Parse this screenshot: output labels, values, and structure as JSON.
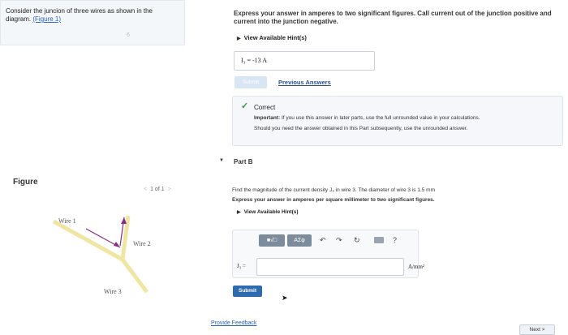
{
  "intro": {
    "text": "Consider the juncion of three wires as shown in the diagram. ",
    "figure_link": "(Figure 1)",
    "faint_digit": "6"
  },
  "figure": {
    "label": "Figure",
    "pager_prev": "<",
    "pager_text": "1 of 1",
    "pager_next": ">",
    "wire_labels": {
      "wire1": "Wire 1",
      "wire2": "Wire 2",
      "wire3": "Wire 3"
    }
  },
  "part_a": {
    "instruction": "Express your answer in amperes to two significant figures. Call current out of the junction positive and current into the junction negative.",
    "hints_label": "View Available Hint(s)",
    "answer": "I₃ = -13  A",
    "submit_label": "Submit",
    "previous_answers": "Previous Answers",
    "correct_title": "Correct",
    "correct_important": "Important:",
    "correct_line1": " If you use this answer in later parts, use the full unrounded value in your calculations.",
    "correct_line2": "Should you need the answer obtained in this Part subsequently, use the unrounded answer."
  },
  "part_b": {
    "title": "Part B",
    "question": "Find the magnitude of the current density J₃ in wire 3. The diameter of wire 3 is 1.5 mm",
    "instruction": "Express your answer in amperes per square millimeter to two significant figures.",
    "hints_label": "View Available Hint(s)",
    "toolbar": {
      "template": "■√□",
      "symbols": "AΣφ",
      "undo": "↶",
      "redo": "↷",
      "reset": "↻",
      "help": "?"
    },
    "var_label": "J₃ =",
    "input_value": "",
    "units": "A/mm²",
    "submit_label": "Submit"
  },
  "footer": {
    "feedback": "Provide Feedback",
    "next": "Next >"
  },
  "colors": {
    "link": "#2a62b8",
    "submit": "#2e6ab0",
    "correct": "#3a9a3a"
  }
}
